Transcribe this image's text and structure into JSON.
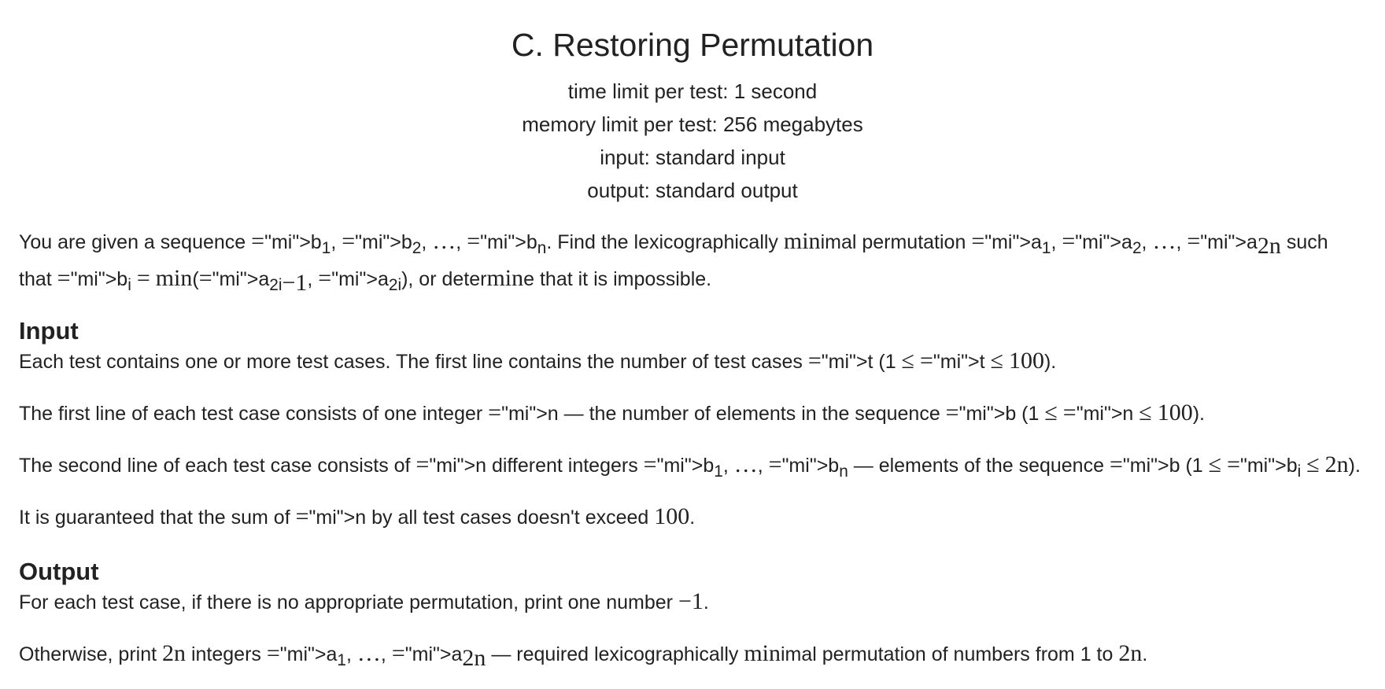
{
  "problem": {
    "title": "C. Restoring Permutation",
    "time_limit": "time limit per test: 1 second",
    "memory_limit": "memory limit per test: 256 megabytes",
    "input_file": "input: standard input",
    "output_file": "output: standard output"
  },
  "statement": {
    "p1": "You are given a sequence b1, b2, …, bn. Find the lexicographically minimal permutation a1, a2, …, a2n such that bi = min(a2i−1, a2i), or determine that it is impossible."
  },
  "input_section": {
    "heading": "Input",
    "p1": "Each test contains one or more test cases. The first line contains the number of test cases t (1 ≤ t ≤ 100).",
    "p2": "The first line of each test case consists of one integer n — the number of elements in the sequence b (1 ≤ n ≤ 100).",
    "p3": "The second line of each test case consists of n different integers b1, …, bn — elements of the sequence b (1 ≤ bi ≤ 2n).",
    "p4": "It is guaranteed that the sum of n by all test cases doesn't exceed 100."
  },
  "output_section": {
    "heading": "Output",
    "p1": "For each test case, if there is no appropriate permutation, print one number −1.",
    "p2": "Otherwise, print 2n integers a1, …, a2n — required lexicographically minimal permutation of numbers from 1 to 2n."
  }
}
